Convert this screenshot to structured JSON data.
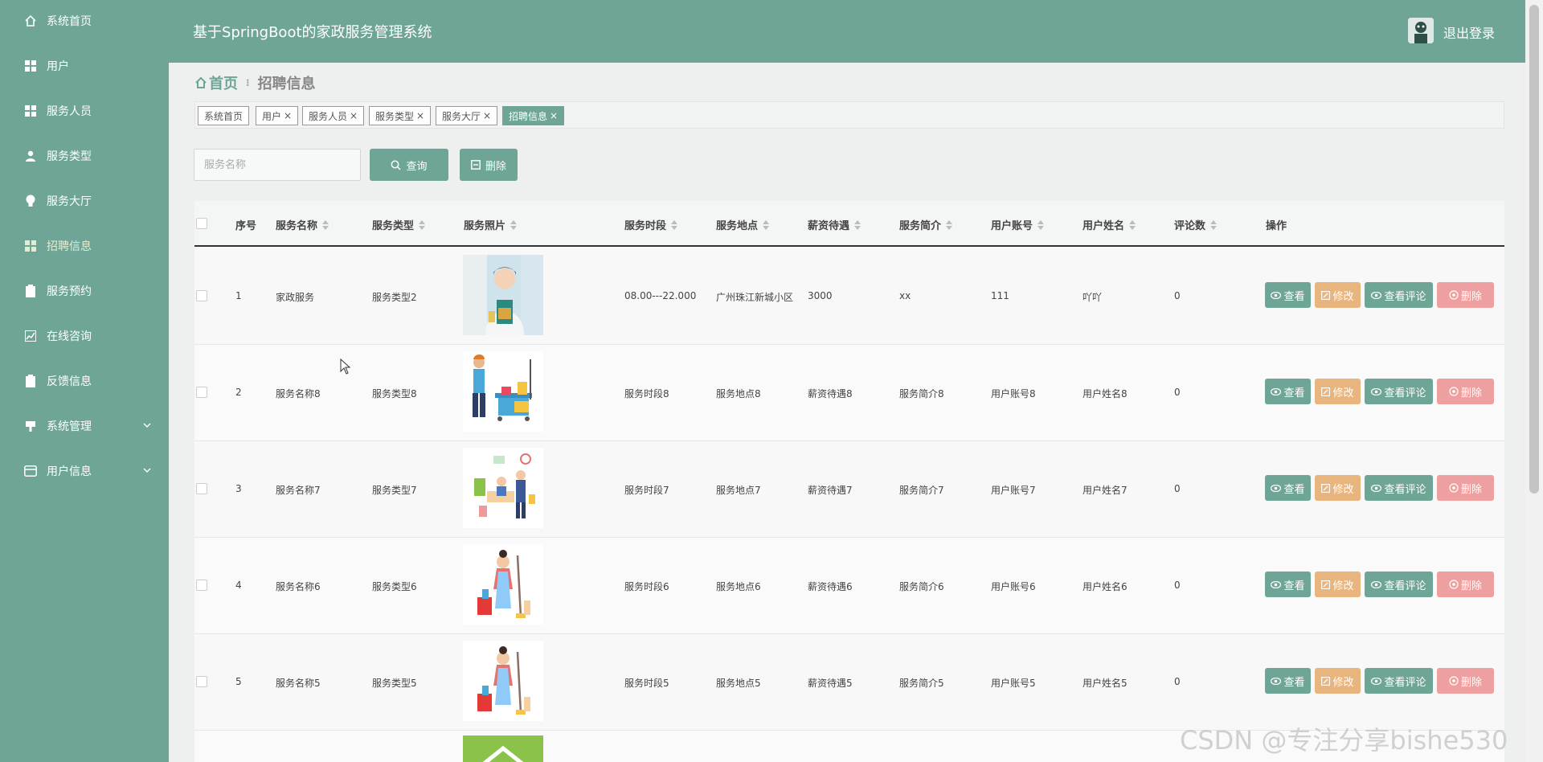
{
  "sidebar": {
    "items": [
      {
        "label": "系统首页",
        "icon": "home-icon"
      },
      {
        "label": "用户",
        "icon": "grid-icon"
      },
      {
        "label": "服务人员",
        "icon": "grid-icon"
      },
      {
        "label": "服务类型",
        "icon": "user-icon"
      },
      {
        "label": "服务大厅",
        "icon": "lightbulb-icon"
      },
      {
        "label": "招聘信息",
        "icon": "grid-icon"
      },
      {
        "label": "服务预约",
        "icon": "clipboard-icon"
      },
      {
        "label": "在线咨询",
        "icon": "chart-icon"
      },
      {
        "label": "反馈信息",
        "icon": "clipboard-icon"
      },
      {
        "label": "系统管理",
        "icon": "flag-icon"
      },
      {
        "label": "用户信息",
        "icon": "card-icon"
      }
    ]
  },
  "header": {
    "title": "基于SpringBoot的家政服务管理系统",
    "logout_label": "退出登录"
  },
  "breadcrumb": {
    "home": "首页",
    "current": "招聘信息"
  },
  "tags": [
    {
      "label": "系统首页",
      "closable": false,
      "active": false
    },
    {
      "label": "用户",
      "closable": true,
      "active": false
    },
    {
      "label": "服务人员",
      "closable": true,
      "active": false
    },
    {
      "label": "服务类型",
      "closable": true,
      "active": false
    },
    {
      "label": "服务大厅",
      "closable": true,
      "active": false
    },
    {
      "label": "招聘信息",
      "closable": true,
      "active": true
    }
  ],
  "search": {
    "placeholder": "服务名称",
    "query_label": "查询",
    "delete_label": "删除"
  },
  "table": {
    "headers": {
      "index": "序号",
      "name": "服务名称",
      "type": "服务类型",
      "photo": "服务照片",
      "time": "服务时段",
      "place": "服务地点",
      "salary": "薪资待遇",
      "intro": "服务简介",
      "account": "用户账号",
      "username": "用户姓名",
      "comments": "评论数",
      "ops": "操作"
    },
    "rows": [
      {
        "index": "1",
        "name": "家政服务",
        "type": "服务类型2",
        "time": "08.00---22.000",
        "place": "广州珠江新城小区",
        "salary": "3000",
        "intro": "xx",
        "account": "111",
        "username": "吖吖",
        "comments": "0"
      },
      {
        "index": "2",
        "name": "服务名称8",
        "type": "服务类型8",
        "time": "服务时段8",
        "place": "服务地点8",
        "salary": "薪资待遇8",
        "intro": "服务简介8",
        "account": "用户账号8",
        "username": "用户姓名8",
        "comments": "0"
      },
      {
        "index": "3",
        "name": "服务名称7",
        "type": "服务类型7",
        "time": "服务时段7",
        "place": "服务地点7",
        "salary": "薪资待遇7",
        "intro": "服务简介7",
        "account": "用户账号7",
        "username": "用户姓名7",
        "comments": "0"
      },
      {
        "index": "4",
        "name": "服务名称6",
        "type": "服务类型6",
        "time": "服务时段6",
        "place": "服务地点6",
        "salary": "薪资待遇6",
        "intro": "服务简介6",
        "account": "用户账号6",
        "username": "用户姓名6",
        "comments": "0"
      },
      {
        "index": "5",
        "name": "服务名称5",
        "type": "服务类型5",
        "time": "服务时段5",
        "place": "服务地点5",
        "salary": "薪资待遇5",
        "intro": "服务简介5",
        "account": "用户账号5",
        "username": "用户姓名5",
        "comments": "0"
      }
    ],
    "actions": {
      "view": "查看",
      "edit": "修改",
      "comment": "查看评论",
      "delete": "删除"
    }
  },
  "watermark": "CSDN @专注分享bishe530",
  "colors": {
    "primary": "#6ea597",
    "edit": "#e8b57f",
    "delete": "#ee9f9f"
  }
}
